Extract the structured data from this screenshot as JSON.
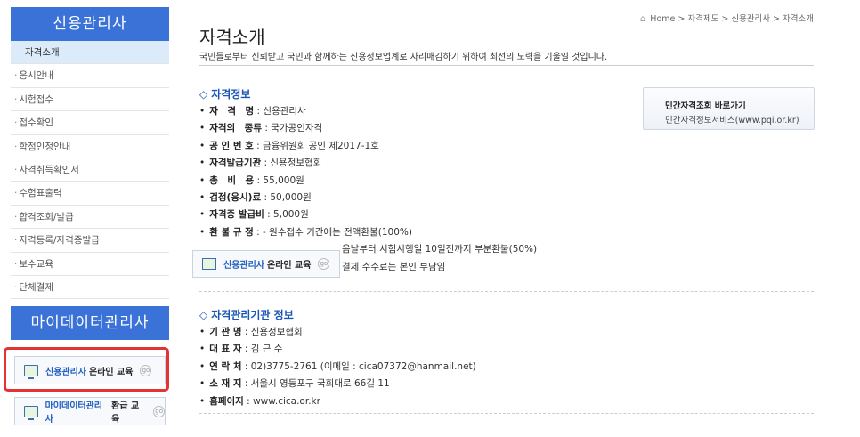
{
  "sidebar": {
    "title1": "신용관리사",
    "items": [
      {
        "label": "자격소개",
        "active": true
      },
      {
        "label": "응시안내"
      },
      {
        "label": "시험접수"
      },
      {
        "label": "접수확인"
      },
      {
        "label": "학점인정안내"
      },
      {
        "label": "자격취득확인서"
      },
      {
        "label": "수험표출력"
      },
      {
        "label": "합격조회/발급"
      },
      {
        "label": "자격등록/자격증발급"
      },
      {
        "label": "보수교육"
      },
      {
        "label": "단체결제"
      }
    ],
    "title2": "마이데이터관리사",
    "edu1": {
      "blue": "신용관리사",
      "dark": "온라인 교육",
      "go": "go"
    },
    "edu2": {
      "blue": "마이데이터관리사",
      "dark": "환급 교육",
      "go": "go"
    }
  },
  "breadcrumb": [
    "Home",
    "자격제도",
    "신용관리사",
    "자격소개"
  ],
  "page": {
    "title": "자격소개",
    "intro": "국민들로부터 신뢰받고 국민과 함께하는 신용정보업계로 자리매김하기 위하여 최선의 노력을 기울일 것입니다."
  },
  "qualification": {
    "title": "자격정보",
    "rows": [
      {
        "key": "자　격　명",
        "value": "신용관리사"
      },
      {
        "key": "자격의　종류",
        "value": "국가공인자격"
      },
      {
        "key": "공 인 번 호",
        "value": "금융위원회 공인 제2017-1호"
      },
      {
        "key": "자격발급기관",
        "value": "신용정보협회"
      },
      {
        "key": "총　비　용",
        "value": "55,000원"
      },
      {
        "key": "검정(응시)료",
        "value": "50,000원"
      },
      {
        "key": "자격증 발급비",
        "value": "5,000원"
      },
      {
        "key": "환 불 규 정",
        "value": "- 원수접수 기간에는 전액환불(100%)"
      }
    ],
    "refund_extra": [
      "음날부터 시험시행일 10일전까지 부분환불(50%)",
      "결제 수수료는 본인 부담임"
    ],
    "pqi": {
      "title": "민간자격조회 바로가기",
      "sub": "민간자격정보서비스(www.pqi.or.kr)"
    },
    "popup": {
      "blue": "신용관리사",
      "dark": "온라인 교육",
      "go": "go"
    }
  },
  "agency": {
    "title": "자격관리기관 정보",
    "rows": [
      {
        "key": "기 관 명",
        "value": "신용정보협회"
      },
      {
        "key": "대 표 자",
        "value": "김 근 수"
      },
      {
        "key": "연 락 처",
        "value": "02)3775-2761 (이메일 : cica07372@hanmail.net)"
      },
      {
        "key": "소 재 지",
        "value": "서울시 영등포구 국회대로 66길 11"
      },
      {
        "key": "홈페이지",
        "value": "www.cica.or.kr"
      }
    ]
  }
}
